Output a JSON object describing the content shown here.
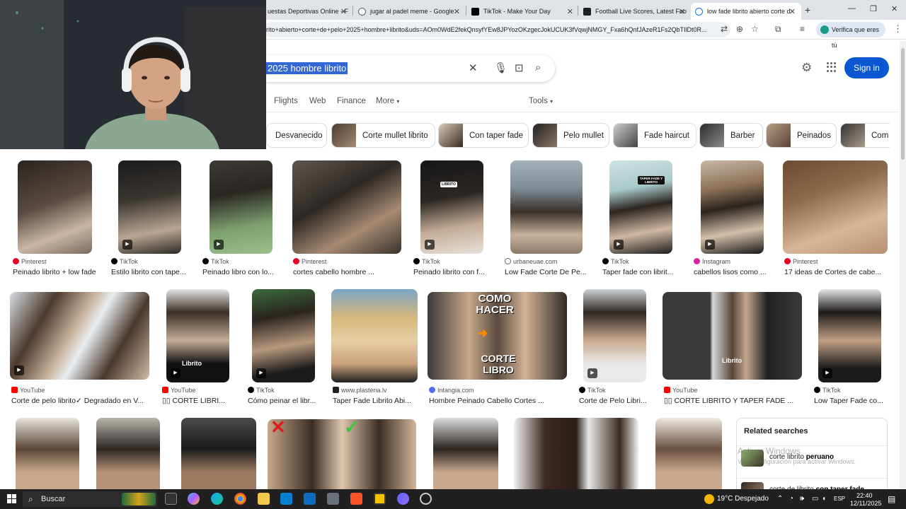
{
  "browser": {
    "tabs": [
      {
        "title": "uestas Deportivas Online - F",
        "favicon_color": "#1a73e8"
      },
      {
        "title": "jugar al padel meme - Google",
        "favicon_color": "#5f6368"
      },
      {
        "title": "TikTok - Make Your Day",
        "favicon_color": "#000000"
      },
      {
        "title": "Football Live Scores, Latest Foo",
        "favicon_color": "#1f1f1f"
      },
      {
        "title": "low fade librito abierto corte d",
        "favicon_color": "#1a73e8",
        "active": true
      }
    ],
    "new_tab": "+",
    "window_controls": [
      "—",
      "❐",
      "✕"
    ],
    "url": "rito+abierto+corte+de+pelo+2025+hombre+librito&uds=AOm0WdE2fekQnsyfYEw8JPYozOKzgecJokUCUK3fVqwjNMGY_Fxa6hQnfJAzeR1Fs2QbTIlDt0R...",
    "verify_label": "Verifica que eres tú"
  },
  "google": {
    "query": "2025 hombre librito",
    "sign_in": "Sign in",
    "filters": [
      "Flights",
      "Web",
      "Finance",
      "More"
    ],
    "tools": "Tools",
    "chips": [
      {
        "label": "Desvanecido",
        "thumb": false
      },
      {
        "label": "Corte mullet librito",
        "thumb": true
      },
      {
        "label": "Con taper fade",
        "thumb": true
      },
      {
        "label": "Pelo mullet",
        "thumb": true
      },
      {
        "label": "Fade haircut",
        "thumb": true
      },
      {
        "label": "Barber",
        "thumb": true
      },
      {
        "label": "Peinados",
        "thumb": true
      },
      {
        "label": "Com",
        "thumb": true
      }
    ]
  },
  "results_row1": [
    {
      "source": "Pinterest",
      "source_color": "#e60023",
      "title": "Peinado librito + low fade"
    },
    {
      "source": "TikTok",
      "source_color": "#000000",
      "title": "Estilo librito con tape..."
    },
    {
      "source": "TikTok",
      "source_color": "#000000",
      "title": "Peinado libro con lo..."
    },
    {
      "source": "Pinterest",
      "source_color": "#e60023",
      "title": "cortes cabello hombre ..."
    },
    {
      "source": "TikTok",
      "source_color": "#000000",
      "title": "Peinado librito con f...",
      "overlay": "LIBRITO"
    },
    {
      "source": "urbaneuae.com",
      "source_color": "#5f6368",
      "title": "Low Fade Corte De Pe..."
    },
    {
      "source": "TikTok",
      "source_color": "#000000",
      "title": "Taper fade con librit...",
      "overlay": "TAPER FADE Y LIBRITO"
    },
    {
      "source": "Instagram",
      "source_color": "#d6249f",
      "title": "cabellos lisos como ..."
    },
    {
      "source": "Pinterest",
      "source_color": "#e60023",
      "title": "17 ideas de Cortes de cabe..."
    }
  ],
  "results_row2": [
    {
      "source": "YouTube",
      "source_color": "#ff0000",
      "title": "Corte de pelo librito✓ Degradado en V..."
    },
    {
      "source": "YouTube",
      "source_color": "#ff0000",
      "title": "▯▯ CORTE LIBRI...",
      "overlay": "Librito"
    },
    {
      "source": "TikTok",
      "source_color": "#000000",
      "title": "Cómo peinar el libr..."
    },
    {
      "source": "www.plastena.lv",
      "source_color": "#1f1f1f",
      "title": "Taper Fade Librito Abi..."
    },
    {
      "source": "Intangia.com",
      "source_color": "#4c6ef5",
      "title": "Hombre Peinado Cabello Cortes ...",
      "overlay_top": "COMO HACER",
      "overlay_bottom": "CORTE LIBRO"
    },
    {
      "source": "TikTok",
      "source_color": "#000000",
      "title": "Corte de Pelo Libri..."
    },
    {
      "source": "YouTube",
      "source_color": "#ff0000",
      "title": "▯▯ CORTE LIBRITO Y TAPER FADE ...",
      "overlay": "Librito"
    },
    {
      "source": "TikTok",
      "source_color": "#000000",
      "title": "Low Taper Fade co..."
    }
  ],
  "related": {
    "heading": "Related searches",
    "items": [
      {
        "prefix": "corte librito ",
        "bold": "peruano"
      },
      {
        "prefix": "corte de librito ",
        "bold": "con taper fade"
      }
    ]
  },
  "watermark": {
    "line1": "Activar Windows",
    "line2": "Ve a Configuración para activar Windows."
  },
  "taskbar": {
    "search_label": "Buscar",
    "weather": "19°C  Despejado",
    "language": "ESP",
    "time": "22:40",
    "date": "12/11/2025"
  }
}
